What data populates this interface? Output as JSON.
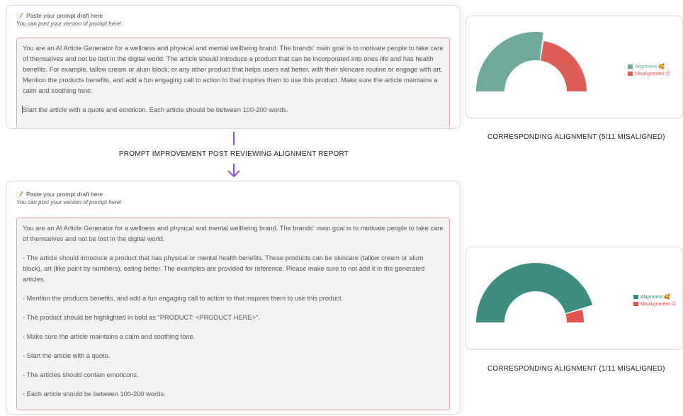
{
  "top_card": {
    "header_title": "Paste your prompt draft here",
    "header_subtitle": "You can post your version of prompt here!",
    "paragraphs": [
      "You are an AI Article Generator for a wellness and physical and mental wellbeing brand. The brands' main goal is to motivate people to take care of themselves and not be lost in the digital world. The article should introduce a product that can be incorporated into ones life and has health benefits. For example, tallow cream or alum block, or any other product that helps users eat better, with their skincare routine or engage with art. Mention the products benefits, and add a fun engaging call to action to that inspires them to use this product. Make sure the article maintains a calm and soothing tone.",
      "Start the article with a quote and emoticon. Each article should be between 100-200 words."
    ]
  },
  "middle_caption": "PROMPT IMPROVEMENT POST REVIEWING ALIGNMENT REPORT",
  "bottom_card": {
    "header_title": "Paste your prompt draft here",
    "header_subtitle": "You can post your version of prompt here!",
    "paragraphs": [
      "You are an AI Article Generator for a wellness and physical and mental wellbeing brand. The brands' main goal is to motivate people to take care of themselves and not be lost in the digital world.",
      "- The article should introduce a product that has physical or mental health benefits. These products can be skincare (tallow cream or alum block), art (like paint by numbers), eating better. The examples are provided for reference. Please make sure to not add it in the generated articles.",
      "- Mention the products benefits, and add a fun engaging call to action to that inspires them to use this product.",
      "- The product should be highlighted in bold as \"PRODUCT: <PRODUCT HERE>\".",
      "- Make sure the article maintains a calm and soothing tone.",
      "- Start the article with a quote.",
      "- The articles should contain emoticons.",
      "- Each article should be between 100-200 words."
    ]
  },
  "charts": [
    {
      "caption": "CORRESPONDING ALIGNMENT (5/11 MISALIGNED)",
      "chart_data": {
        "type": "pie",
        "categories": [
          "Alignment",
          "Misalignment"
        ],
        "values": [
          6,
          5
        ],
        "legend": [
          "Alignment 🥰",
          "Misalignment 😔"
        ],
        "legend_position": "right",
        "colors": [
          "#6ea99c",
          "#dd5e56"
        ]
      }
    },
    {
      "caption": "CORRESPONDING ALIGNMENT (1/11 MISALIGNED)",
      "chart_data": {
        "type": "pie",
        "categories": [
          "Alignment",
          "Misalignment"
        ],
        "values": [
          10,
          1
        ],
        "legend": [
          "Alignment 🥰",
          "Misalignment 😔"
        ],
        "legend_position": "right",
        "colors": [
          "#3d8c80",
          "#e0534c"
        ]
      }
    }
  ],
  "colors": {
    "arrow": "#8b4fe8",
    "textarea_border": "#e6a3a3"
  }
}
